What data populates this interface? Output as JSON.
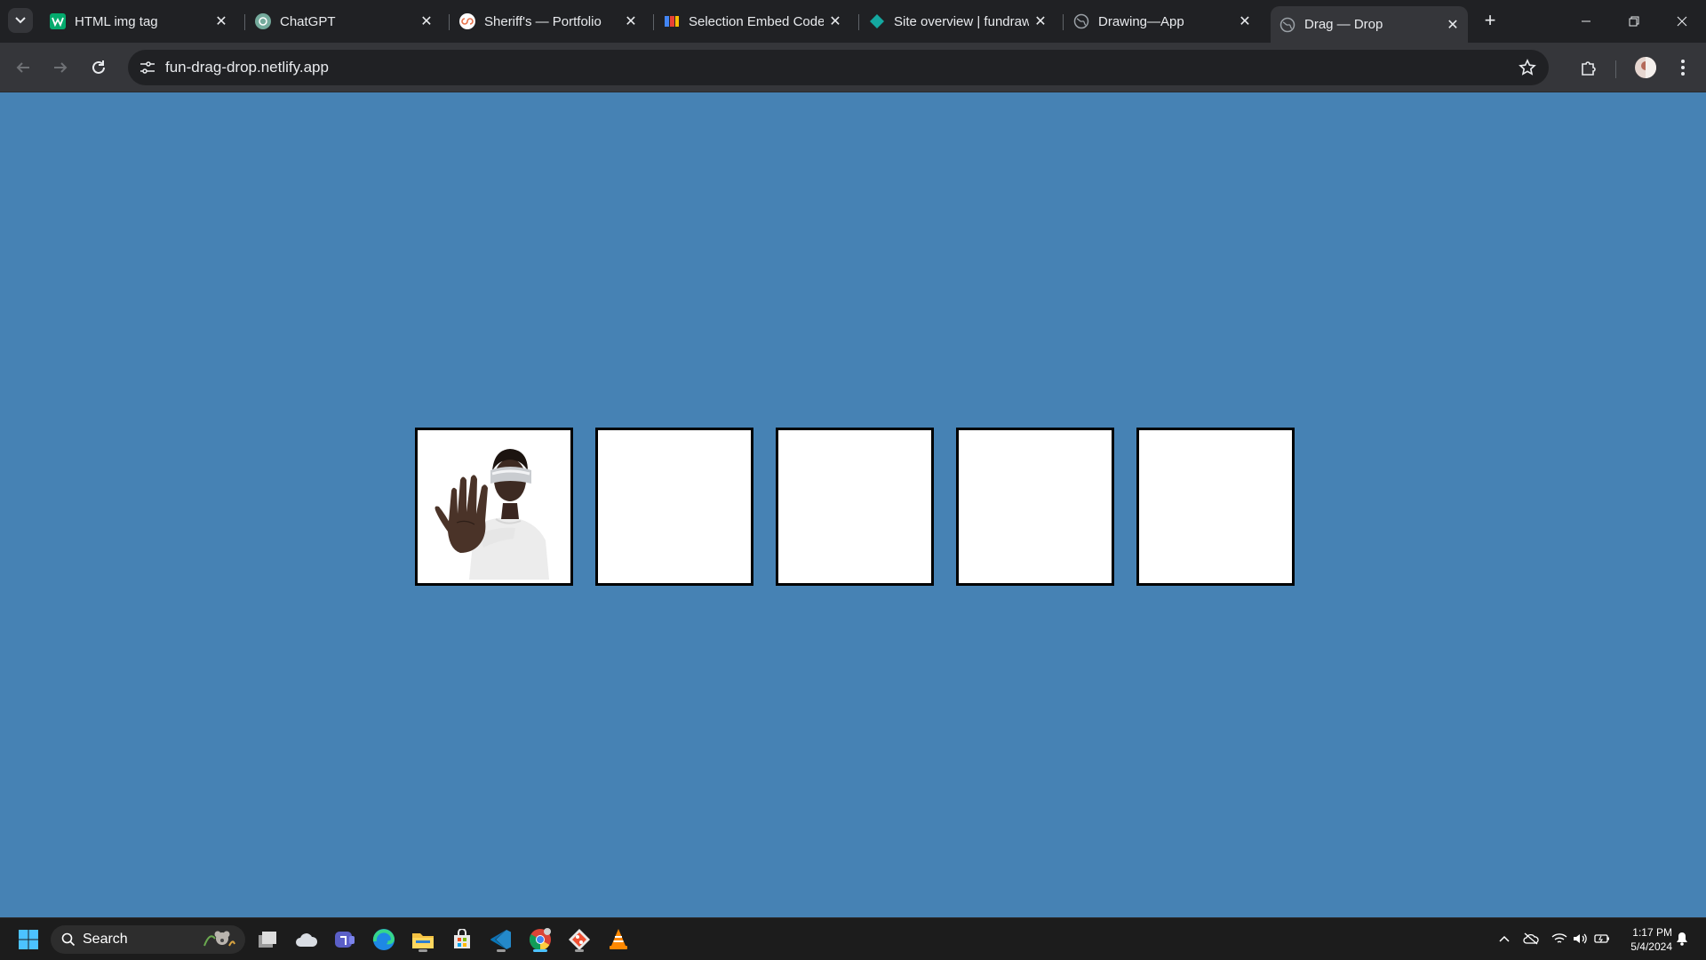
{
  "browser": {
    "tabs": [
      {
        "title": "HTML img tag",
        "icon": "w3schools-icon",
        "color": "#04aa6d"
      },
      {
        "title": "ChatGPT",
        "icon": "chatgpt-icon",
        "color": "#74aa9c"
      },
      {
        "title": "Sheriff's — Portfolio",
        "icon": "portfolio-icon",
        "color": "#e8a87c"
      },
      {
        "title": "Selection Embed Code",
        "icon": "embed-icon",
        "color": "#e94235"
      },
      {
        "title": "Site overview | fundraw",
        "icon": "netlify-icon",
        "color": "#14a8a0"
      },
      {
        "title": "Drawing—App",
        "icon": "globe-icon",
        "color": "#9aa0a6"
      },
      {
        "title": "Drag — Drop",
        "icon": "globe-icon",
        "color": "#9aa0a6",
        "active": true
      }
    ],
    "url": "fun-drag-drop.netlify.app"
  },
  "page": {
    "background": "#4682b4",
    "boxes": [
      {
        "filled": true,
        "content": "photo of a person wearing a visor holding up a hand"
      },
      {
        "filled": false
      },
      {
        "filled": false
      },
      {
        "filled": false
      },
      {
        "filled": false
      }
    ]
  },
  "taskbar": {
    "search_label": "Search",
    "time": "1:17 PM",
    "date": "5/4/2024",
    "apps": [
      "task-view-icon",
      "widgets-icon",
      "teams-icon",
      "edge-icon",
      "file-explorer-icon",
      "store-icon",
      "vscode-icon",
      "chrome-icon",
      "git-icon",
      "vlc-icon"
    ]
  }
}
